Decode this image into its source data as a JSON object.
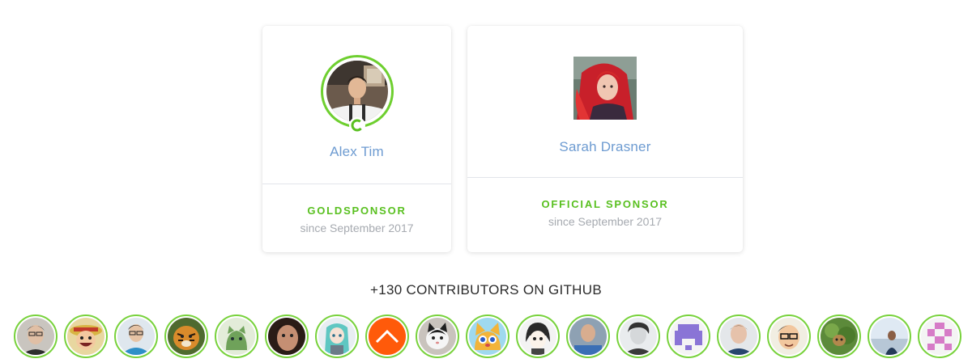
{
  "sponsors": [
    {
      "name": "Alex Tim",
      "tier": "GOLDSPONSOR",
      "since": "since September 2017"
    },
    {
      "name": "Sarah Drasner",
      "tier": "OFFICIAL SPONSOR",
      "since": "since September 2017"
    }
  ],
  "colors": {
    "accent_green": "#59c020",
    "ring_green": "#6ecf2f",
    "name_blue": "#6d9bd1",
    "muted_gray": "#a6aab0"
  },
  "contributors": {
    "heading": "+130 CONTRIBUTORS ON GITHUB",
    "avatars": [
      {
        "icon": "contributor-avatar-1"
      },
      {
        "icon": "contributor-avatar-2"
      },
      {
        "icon": "contributor-avatar-3"
      },
      {
        "icon": "contributor-avatar-4"
      },
      {
        "icon": "contributor-avatar-5"
      },
      {
        "icon": "contributor-avatar-6"
      },
      {
        "icon": "contributor-avatar-7"
      },
      {
        "icon": "contributor-avatar-8"
      },
      {
        "icon": "contributor-avatar-9"
      },
      {
        "icon": "contributor-avatar-10"
      },
      {
        "icon": "contributor-avatar-11"
      },
      {
        "icon": "contributor-avatar-12"
      },
      {
        "icon": "contributor-avatar-13"
      },
      {
        "icon": "contributor-avatar-14"
      },
      {
        "icon": "contributor-avatar-15"
      },
      {
        "icon": "contributor-avatar-16"
      },
      {
        "icon": "contributor-avatar-17"
      },
      {
        "icon": "contributor-avatar-18"
      },
      {
        "icon": "contributor-avatar-19"
      }
    ]
  }
}
